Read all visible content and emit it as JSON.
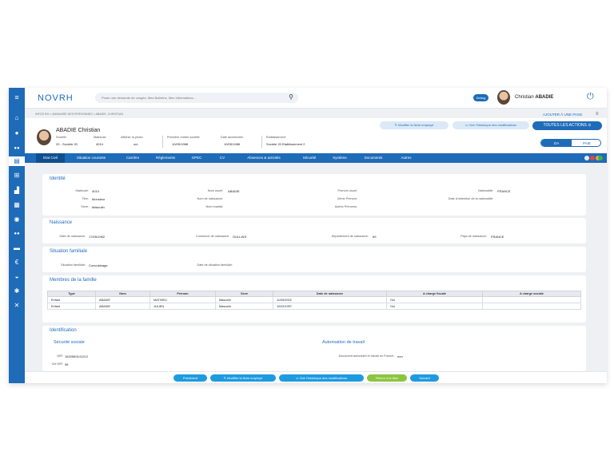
{
  "topbar": {
    "logo": "NOVRH",
    "search_placeholder": "Poser une demande de congés, Mes Bulletins, Mes Informations...",
    "debug_label": "Debug",
    "user_first": "Christian",
    "user_last": "ABADIE"
  },
  "breadcrumb": "INFOS RH  >  ANNUAIRE DES PERSONNES  >  ABADIE, CHRISTIAN",
  "add_page": "AJOUTER À UNE PAGE",
  "employee": {
    "last": "ABADIE",
    "first": "Christian",
    "fields": [
      {
        "label": "Société:",
        "value": "20 - Societe 20"
      },
      {
        "label": "Matricule:",
        "value": "4014"
      },
      {
        "label": "Afficher la photo:",
        "value": "oui"
      },
      {
        "label": "Première entrée société:",
        "value": "10/05/1988"
      },
      {
        "label": "Date ancienneté:",
        "value": "10/05/1988"
      },
      {
        "label": "Etablissement:",
        "value": "Societe 20 Etablissement 2"
      }
    ]
  },
  "header_buttons": {
    "modify": "Modifier la fiche employé",
    "history": "Voir l'historique des modifications",
    "all_actions": "TOUTES LES ACTIONS",
    "ga": "GA",
    "paie": "PAIE"
  },
  "tabs": [
    "Etat Civil",
    "Situation courante",
    "Carrière",
    "Règlements",
    "GPEC",
    "CV",
    "Absences & activités",
    "Sécurité",
    "Système",
    "Documents",
    "Autres"
  ],
  "colors": {
    "primary": "#1e6bb8",
    "dots": [
      "#e9edf3",
      "#e8453c",
      "#f2b134",
      "#39b54a"
    ]
  },
  "identite": {
    "title": "Identité",
    "rows": [
      [
        {
          "l": "Matricule:",
          "v": "4014"
        },
        {
          "l": "Nom usuel:",
          "v": "ABADIE"
        },
        {
          "l": "Prénom usuel:",
          "v": ""
        },
        {
          "l": "Nationalité:",
          "v": "FRANCE"
        }
      ],
      [
        {
          "l": "Titre:",
          "v": "Monsieur"
        },
        {
          "l": "Nom de naissance:",
          "v": ""
        },
        {
          "l": "2ème Prénom:",
          "v": ""
        },
        {
          "l": "Date d'obtention de la nationalité:",
          "v": ""
        }
      ],
      [
        {
          "l": "Sexe:",
          "v": "Masculin"
        },
        {
          "l": "Nom marital:",
          "v": ""
        },
        {
          "l": "Autres Prénoms:",
          "v": ""
        }
      ]
    ]
  },
  "naissance": {
    "title": "Naissance",
    "fields": [
      {
        "l": "Date de naissance:",
        "v": "17/05/1962"
      },
      {
        "l": "Commune de naissance:",
        "v": "OULLINS"
      },
      {
        "l": "Département de naissance:",
        "v": "69"
      },
      {
        "l": "Pays de naissance:",
        "v": "FRANCE"
      }
    ]
  },
  "situation": {
    "title": "Situation familiale",
    "fields": [
      {
        "l": "Situation familiale:",
        "v": "Concubinage"
      },
      {
        "l": "Date de situation familiale:",
        "v": ""
      }
    ]
  },
  "famille": {
    "title": "Membres de la famille",
    "headers": [
      "Type",
      "Nom",
      "Prénom",
      "Sexe",
      "Date de naissance",
      "A charge fiscale",
      "A charge sociale"
    ],
    "rows": [
      [
        "Enfant",
        "ABADIE",
        "MATHIEU",
        "Masculin",
        "11/05/2002",
        "Oui",
        ""
      ],
      [
        "Enfant",
        "ABADIE",
        "JULIEN",
        "Masculin",
        "12/02/1997",
        "Oui",
        ""
      ]
    ]
  },
  "identification": {
    "title": "Identification",
    "secu_title": "Sécurité sociale",
    "auth_title": "Autorisation de travail",
    "nir_label": "NIR:",
    "nir_value": "1620569141212",
    "cle_label": "Clé NIR:",
    "cle_value": "96",
    "auth_label": "Document autorisant le travail en France:",
    "auth_value": "non"
  },
  "bottom": {
    "prev": "Précédent",
    "modify": "Modifier la fiche employé",
    "history": "Voir l'historique des modifications",
    "back": "Retour à la liste",
    "next": "Suivant",
    "back_color": "#8bc53f"
  },
  "icons": [
    "hamburger-icon",
    "home-icon",
    "person-icon",
    "team-icon",
    "id-card-icon",
    "org-icon",
    "chart-icon",
    "calendar-icon",
    "help-icon",
    "group-icon",
    "stack-icon",
    "euro-icon",
    "gauge-icon",
    "settings-icon",
    "tools-icon"
  ]
}
